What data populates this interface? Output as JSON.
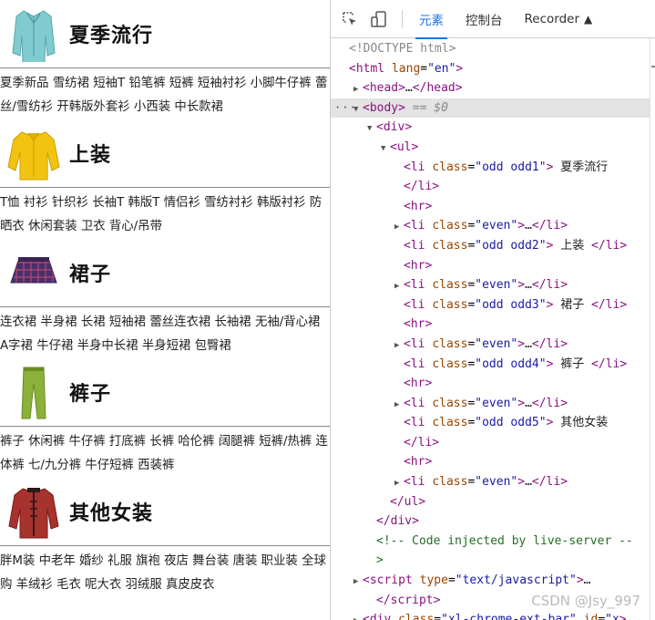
{
  "left_page": {
    "categories": [
      {
        "title": "夏季流行",
        "icon": "jacket-teal-icon",
        "links": "夏季新品 雪纺裙 短袖T 铅笔裤 短裤 短袖衬衫 小脚牛仔裤 蕾丝/雪纺衫 开韩版外套衫 小西装 中长款裙"
      },
      {
        "title": "上装",
        "icon": "yellow-shirt-icon",
        "links": "T恤 衬衫 针织衫 长袖T 韩版T 情侣衫 雪纺衬衫 韩版衬衫 防晒衣 休闲套装 卫衣 背心/吊带"
      },
      {
        "title": "裙子",
        "icon": "plaid-skirt-icon",
        "links": "连衣裙 半身裙 长裙 短袖裙 蕾丝连衣裙 长袖裙 无袖/背心裙 A字裙 牛仔裙 半身中长裙 半身短裙 包臀裙"
      },
      {
        "title": "裤子",
        "icon": "green-pants-icon",
        "links": "裤子 休闲裤 牛仔裤 打底裤 长裤 哈伦裤 阔腿裤 短裤/热裤 连体裤 七/九分裤 牛仔短裤 西装裤"
      },
      {
        "title": "其他女装",
        "icon": "red-coat-icon",
        "links": "胖M装 中老年 婚纱 礼服 旗袍 夜店 舞台装 唐装 职业装 全球购 羊绒衫 毛衣 呢大衣 羽绒服 真皮皮衣"
      }
    ]
  },
  "devtools": {
    "toolbar": {
      "inspect_icon": "inspect-cursor-icon",
      "device_icon": "device-toggle-icon",
      "tabs": [
        {
          "label": "元素",
          "active": true
        },
        {
          "label": "控制台",
          "active": false
        },
        {
          "label": "Recorder",
          "active": false
        }
      ]
    },
    "dom_lines": [
      {
        "indent": 0,
        "arrow": "",
        "html": "doc",
        "text": "<!DOCTYPE html>"
      },
      {
        "indent": 0,
        "arrow": "",
        "html": "open",
        "tag": "html",
        "attrs": [
          [
            "lang",
            "\"en\""
          ]
        ],
        "tail": ""
      },
      {
        "indent": 1,
        "arrow": "right",
        "html": "collapsed",
        "tag": "head",
        "mid": "…",
        "tail": ""
      },
      {
        "indent": 1,
        "arrow": "down",
        "html": "body",
        "tag": "body",
        "dim": " == $0"
      },
      {
        "indent": 2,
        "arrow": "down",
        "html": "open",
        "tag": "div",
        "attrs": [],
        "tail": ""
      },
      {
        "indent": 3,
        "arrow": "down",
        "html": "open",
        "tag": "ul",
        "attrs": [],
        "tail": ""
      },
      {
        "indent": 4,
        "arrow": "",
        "html": "open",
        "tag": "li",
        "attrs": [
          [
            "class",
            "\"odd odd1\""
          ]
        ],
        "tail": " 夏季流行"
      },
      {
        "indent": 4,
        "arrow": "",
        "html": "close",
        "tag": "li"
      },
      {
        "indent": 4,
        "arrow": "",
        "html": "open",
        "tag": "hr",
        "attrs": [],
        "tail": ""
      },
      {
        "indent": 4,
        "arrow": "right",
        "html": "collapsed",
        "tag": "li",
        "attrs": [
          [
            "class",
            "\"even\""
          ]
        ],
        "mid": "…",
        "tail": ""
      },
      {
        "indent": 4,
        "arrow": "",
        "html": "inline",
        "tag": "li",
        "attrs": [
          [
            "class",
            "\"odd odd2\""
          ]
        ],
        "tail": " 上装 "
      },
      {
        "indent": 4,
        "arrow": "",
        "html": "open",
        "tag": "hr",
        "attrs": [],
        "tail": ""
      },
      {
        "indent": 4,
        "arrow": "right",
        "html": "collapsed",
        "tag": "li",
        "attrs": [
          [
            "class",
            "\"even\""
          ]
        ],
        "mid": "…",
        "tail": ""
      },
      {
        "indent": 4,
        "arrow": "",
        "html": "inline",
        "tag": "li",
        "attrs": [
          [
            "class",
            "\"odd odd3\""
          ]
        ],
        "tail": " 裙子 "
      },
      {
        "indent": 4,
        "arrow": "",
        "html": "open",
        "tag": "hr",
        "attrs": [],
        "tail": ""
      },
      {
        "indent": 4,
        "arrow": "right",
        "html": "collapsed",
        "tag": "li",
        "attrs": [
          [
            "class",
            "\"even\""
          ]
        ],
        "mid": "…",
        "tail": ""
      },
      {
        "indent": 4,
        "arrow": "",
        "html": "inline",
        "tag": "li",
        "attrs": [
          [
            "class",
            "\"odd odd4\""
          ]
        ],
        "tail": " 裤子 "
      },
      {
        "indent": 4,
        "arrow": "",
        "html": "open",
        "tag": "hr",
        "attrs": [],
        "tail": ""
      },
      {
        "indent": 4,
        "arrow": "right",
        "html": "collapsed",
        "tag": "li",
        "attrs": [
          [
            "class",
            "\"even\""
          ]
        ],
        "mid": "…",
        "tail": ""
      },
      {
        "indent": 4,
        "arrow": "",
        "html": "open",
        "tag": "li",
        "attrs": [
          [
            "class",
            "\"odd odd5\""
          ]
        ],
        "tail": " 其他女装"
      },
      {
        "indent": 4,
        "arrow": "",
        "html": "close",
        "tag": "li"
      },
      {
        "indent": 4,
        "arrow": "",
        "html": "open",
        "tag": "hr",
        "attrs": [],
        "tail": ""
      },
      {
        "indent": 4,
        "arrow": "right",
        "html": "collapsed",
        "tag": "li",
        "attrs": [
          [
            "class",
            "\"even\""
          ]
        ],
        "mid": "…",
        "tail": ""
      },
      {
        "indent": 3,
        "arrow": "",
        "html": "close",
        "tag": "ul"
      },
      {
        "indent": 2,
        "arrow": "",
        "html": "close",
        "tag": "div"
      },
      {
        "indent": 2,
        "arrow": "",
        "html": "comment",
        "text": "<!-- Code injected by live-server --"
      },
      {
        "indent": 2,
        "arrow": "",
        "html": "comment",
        "text": ">"
      },
      {
        "indent": 1,
        "arrow": "right",
        "html": "open",
        "tag": "script",
        "attrs": [
          [
            "type",
            "\"text/javascript\""
          ]
        ],
        "tail": "…"
      },
      {
        "indent": 2,
        "arrow": "",
        "html": "close",
        "tag": "script"
      },
      {
        "indent": 1,
        "arrow": "right",
        "html": "open",
        "tag": "div",
        "attrs": [
          [
            "class",
            "\"xl-chrome-ext-bar\""
          ],
          [
            "id",
            "\"x"
          ]
        ],
        "tail": ""
      }
    ],
    "selected_line": 3,
    "dots_label": "···",
    "watermark": "CSDN @Jsy_997"
  }
}
